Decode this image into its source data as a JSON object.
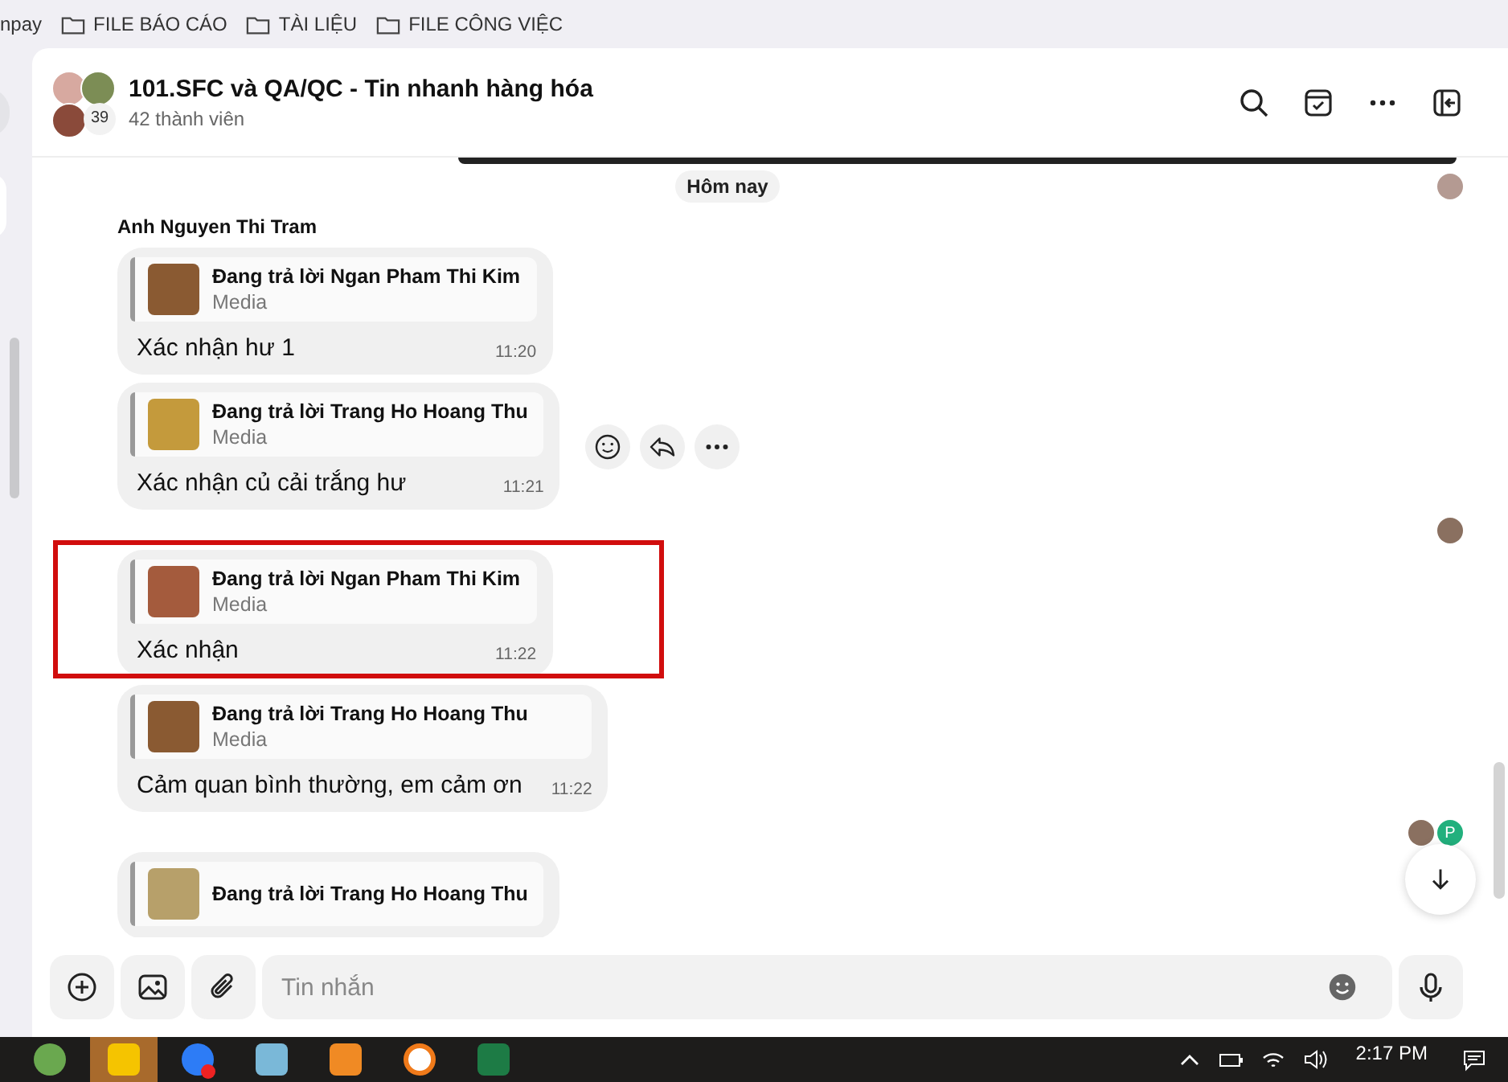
{
  "bookmarks": [
    {
      "label": "npay",
      "folder": false
    },
    {
      "label": "FILE BÁO CÁO",
      "folder": true
    },
    {
      "label": "TÀI LIỆU",
      "folder": true
    },
    {
      "label": "FILE CÔNG VIỆC",
      "folder": true
    }
  ],
  "header": {
    "title": "101.SFC và QA/QC - Tin nhanh hàng hóa",
    "subtitle": "42 thành viên",
    "avatar_count": "39"
  },
  "date_label": "Hôm nay",
  "sender": "Anh Nguyen Thi Tram",
  "items": [
    {
      "kind": "message",
      "reply_to": "Đang trả lời Ngan Pham Thi Kim",
      "reply_type": "Media",
      "text": "Xác nhận hư 1",
      "time": "11:20",
      "highlighted": false,
      "actions": false
    },
    {
      "kind": "message",
      "reply_to": "Đang trả lời Trang Ho Hoang Thu",
      "reply_type": "Media",
      "text": "Xác nhận củ cải trắng hư",
      "time": "11:21",
      "highlighted": false,
      "actions": true
    },
    {
      "kind": "receipt",
      "avatars": [
        {
          "kind": "photo"
        }
      ]
    },
    {
      "kind": "message",
      "reply_to": "Đang trả lời Ngan Pham Thi Kim",
      "reply_type": "Media",
      "text": "Xác nhận",
      "time": "11:22",
      "highlighted": true,
      "actions": false
    },
    {
      "kind": "message",
      "reply_to": "Đang trả lời Trang Ho Hoang Thu",
      "reply_type": "Media",
      "text": "Cảm quan bình thường, em cảm ơn",
      "time": "11:22",
      "highlighted": false,
      "actions": false
    },
    {
      "kind": "receipt",
      "avatars": [
        {
          "kind": "photo"
        },
        {
          "kind": "letter",
          "text": "P",
          "color": "#22b07d"
        }
      ]
    },
    {
      "kind": "message",
      "reply_to": "Đang trả lời Trang Ho Hoang Thu",
      "highlighted": false,
      "actions": false
    }
  ],
  "composer": {
    "placeholder": "Tin nhắn"
  },
  "taskbar": {
    "time": "2:17 PM"
  }
}
